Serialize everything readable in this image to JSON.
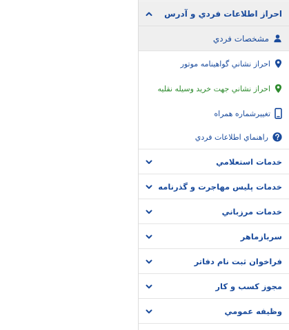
{
  "menu": {
    "section": {
      "title": "احراز اطلاعات فردي و آدرس",
      "icon": "chevron-up-icon"
    },
    "sub_items": [
      {
        "label": "مشخصات فردي",
        "icon": "person-icon",
        "color": "#1a4b9c"
      },
      {
        "label": "احراز نشاني گواهينامه موتور",
        "icon": "map-pin-icon",
        "color": "#1a4b9c"
      },
      {
        "label": "احراز نشاني جهت خريد وسيله نقليه",
        "icon": "map-pin-icon",
        "color": "#2e8b2e"
      },
      {
        "label": "تغييرشماره همراه",
        "icon": "mobile-phone-icon",
        "color": "#1a4b9c"
      },
      {
        "label": "راهنماي اطلاعات فردي",
        "icon": "question-circle-icon",
        "color": "#1a4b9c"
      }
    ],
    "collapsed_sections": [
      {
        "label": "خدمات استعلامي"
      },
      {
        "label": "خدمات پليس مهاجرت و گذرنامه"
      },
      {
        "label": "خدمات مرزباني"
      },
      {
        "label": "سربازماهر"
      },
      {
        "label": "فراخوان ثبت نام دفاتر"
      },
      {
        "label": "مجوز كسب و كار"
      },
      {
        "label": "وظيفه عمومي"
      }
    ]
  }
}
